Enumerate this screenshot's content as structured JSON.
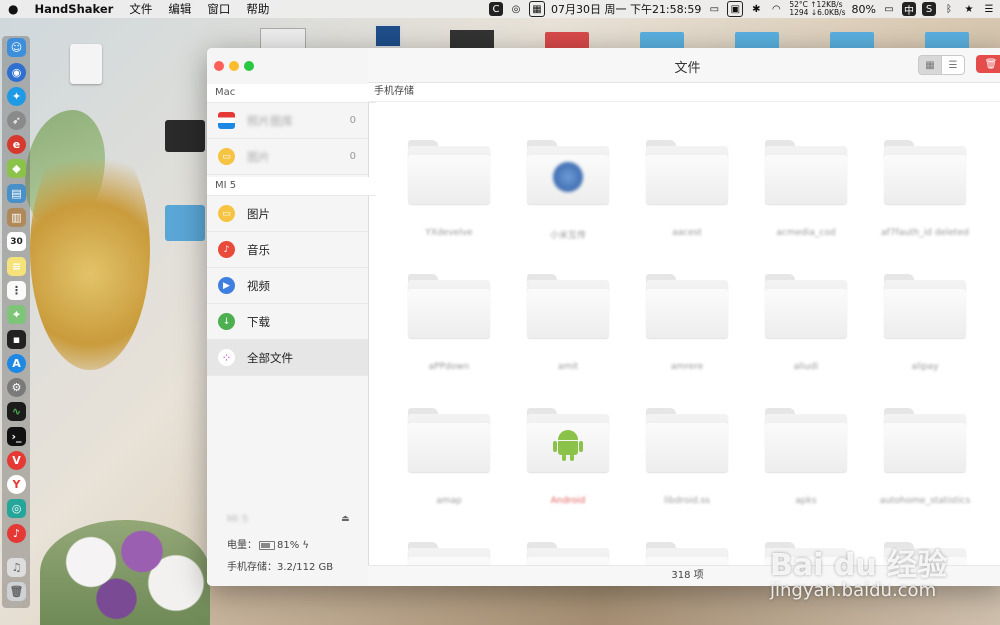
{
  "menubar": {
    "app_name": "HandShaker",
    "menus": [
      "文件",
      "编辑",
      "窗口",
      "帮助"
    ],
    "temperature": "52°C",
    "fan": "1294",
    "upload": "↑12KB/s",
    "download": "↓6.0KB/s",
    "date_time": "07月30日 周一 下午21:58:59",
    "battery": "80%",
    "input_method": "中"
  },
  "window": {
    "title": "文件"
  },
  "sidebar": {
    "mac_section": "Mac",
    "mac_items": [
      {
        "label": "照片图库",
        "count": "0"
      },
      {
        "label": "图片",
        "count": "0"
      }
    ],
    "device_section": "MI 5",
    "device_items": [
      {
        "label": "图片"
      },
      {
        "label": "音乐"
      },
      {
        "label": "视频"
      },
      {
        "label": "下载"
      },
      {
        "label": "全部文件"
      }
    ],
    "device_name": "MI 5",
    "battery_label": "电量：",
    "battery_value": "81%",
    "storage_label": "手机存储：3.2/112 GB"
  },
  "main": {
    "path": "手机存储",
    "folders": [
      {
        "name": "YXdevelve"
      },
      {
        "name": "小米互传"
      },
      {
        "name": "aacest"
      },
      {
        "name": "acmedia_cod"
      },
      {
        "name": "af7fauth_id deleted"
      },
      {
        "name": "aPPdown"
      },
      {
        "name": "amit"
      },
      {
        "name": "amrere"
      },
      {
        "name": "aliudi"
      },
      {
        "name": "alipay"
      },
      {
        "name": "amap"
      },
      {
        "name": "Android"
      },
      {
        "name": "libdroid.ss"
      },
      {
        "name": "apks"
      },
      {
        "name": "autohome_statistics"
      }
    ],
    "item_count": "318 项"
  },
  "watermark": {
    "brand": "Bai du 经验",
    "url": "jingyan.baidu.com"
  },
  "dock_calendar_day": "30"
}
